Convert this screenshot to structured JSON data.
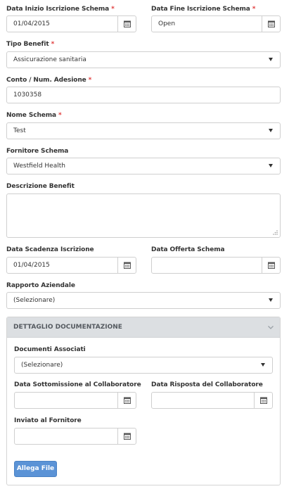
{
  "fields": {
    "data_inizio": {
      "label": "Data Inizio Iscrizione Schema",
      "required_mark": "*",
      "value": "01/04/2015"
    },
    "data_fine": {
      "label": "Data Fine Iscrizione Schema",
      "required_mark": "*",
      "value": "Open"
    },
    "tipo_benefit": {
      "label": "Tipo Benefit",
      "required_mark": "*",
      "value": "Assicurazione sanitaria"
    },
    "conto": {
      "label": "Conto / Num. Adesione",
      "required_mark": "*",
      "value": "1030358"
    },
    "nome_schema": {
      "label": "Nome Schema",
      "required_mark": "*",
      "value": "Test"
    },
    "fornitore_schema": {
      "label": "Fornitore Schema",
      "value": "Westfield Health"
    },
    "descrizione_benefit": {
      "label": "Descrizione Benefit",
      "value": ""
    },
    "data_scadenza": {
      "label": "Data Scadenza Iscrizione",
      "value": "01/04/2015"
    },
    "data_offerta": {
      "label": "Data Offerta Schema",
      "value": ""
    },
    "rapporto_aziendale": {
      "label": "Rapporto Aziendale",
      "value": "(Selezionare)"
    }
  },
  "panel": {
    "title": "DETTAGLIO DOCUMENTAZIONE",
    "documenti_associati": {
      "label": "Documenti Associati",
      "value": "(Selezionare)"
    },
    "data_sottomissione": {
      "label": "Data Sottomissione al Collaboratore",
      "value": ""
    },
    "data_risposta": {
      "label": "Data Risposta del Collaboratore",
      "value": ""
    },
    "inviato_fornitore": {
      "label": "Inviato al Fornitore",
      "value": ""
    },
    "button_label": "Allega File"
  },
  "icons": {
    "date_picker": "calendar-icon",
    "select": "caret-down-icon",
    "collapse": "chevron-down-icon",
    "resize": "resize-grip-icon"
  },
  "colors": {
    "required": "#e03a3a",
    "panel_header": "#dcdfe2",
    "button": "#5b93d6"
  }
}
